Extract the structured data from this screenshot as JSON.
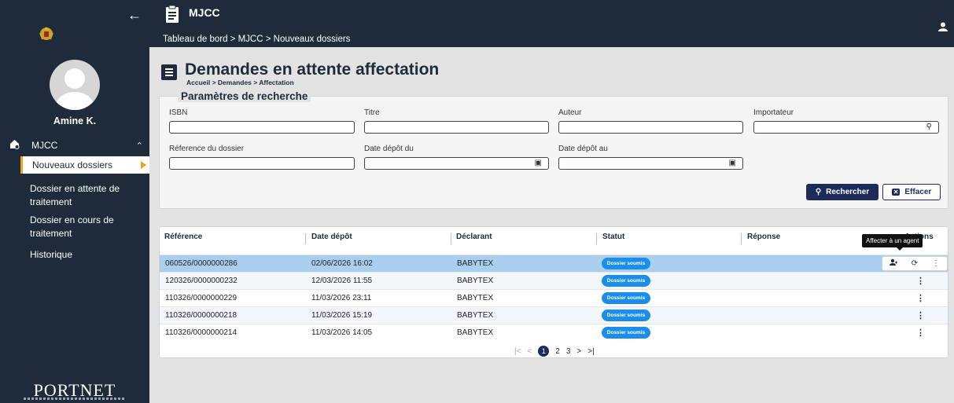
{
  "sidebar": {
    "user_name": "Amine K.",
    "section_label": "MJCC",
    "items": [
      {
        "label": "Nouveaux dossiers"
      },
      {
        "label": "Dossier en attente de traitement"
      },
      {
        "label": "Dossier en cours de traitement"
      },
      {
        "label": "Historique"
      }
    ],
    "logo_text": "PORTNET",
    "icons": {
      "back": "arrow-left-icon",
      "section": "home-icon",
      "collapse": "chevron-up-icon"
    }
  },
  "topbar": {
    "title": "MJCC",
    "breadcrumb": "Tableau de bord > MJCC > Nouveaux dossiers"
  },
  "page": {
    "title": "Demandes en attente affectation",
    "breadcrumb": "Accueil > Demandes > Affectation"
  },
  "search": {
    "legend": "Paramètres de recherche",
    "fields": [
      {
        "label": "ISBN",
        "value": ""
      },
      {
        "label": "Titre",
        "value": ""
      },
      {
        "label": "Auteur",
        "value": ""
      },
      {
        "label": "Importateur",
        "value": ""
      },
      {
        "label": "Réference du dossier",
        "value": ""
      },
      {
        "label": "Date dépôt du",
        "value": ""
      },
      {
        "label": "Date dépôt au",
        "value": ""
      }
    ],
    "search_button": "Rechercher",
    "clear_button": "Effacer"
  },
  "table": {
    "columns": [
      "Référence",
      "Date dépôt",
      "Déclarant",
      "Statut",
      "Réponse",
      "Actions"
    ],
    "rows": [
      {
        "ref": "060526/0000000286",
        "date": "02/06/2026 16:02",
        "declarant": "BABYTEX",
        "status": "Dossier soumis",
        "response": ""
      },
      {
        "ref": "120326/0000000232",
        "date": "12/03/2026 11:55",
        "declarant": "BABYTEX",
        "status": "Dossier soumis",
        "response": ""
      },
      {
        "ref": "110326/0000000229",
        "date": "11/03/2026 23:11",
        "declarant": "BABYTEX",
        "status": "Dossier soumis",
        "response": ""
      },
      {
        "ref": "110326/0000000218",
        "date": "11/03/2026 15:19",
        "declarant": "BABYTEX",
        "status": "Dossier soumis",
        "response": ""
      },
      {
        "ref": "110326/0000000214",
        "date": "11/03/2026 14:05",
        "declarant": "BABYTEX",
        "status": "Dossier soumis",
        "response": ""
      }
    ],
    "tooltip": "Affecter à un agent",
    "pagination": {
      "pages": [
        "1",
        "2",
        "3"
      ],
      "current": "1"
    }
  },
  "colors": {
    "primary": "#1e2b3a",
    "accent": "#f0a020",
    "badge": "#1a8ee8",
    "selected_row": "#aacfee"
  }
}
